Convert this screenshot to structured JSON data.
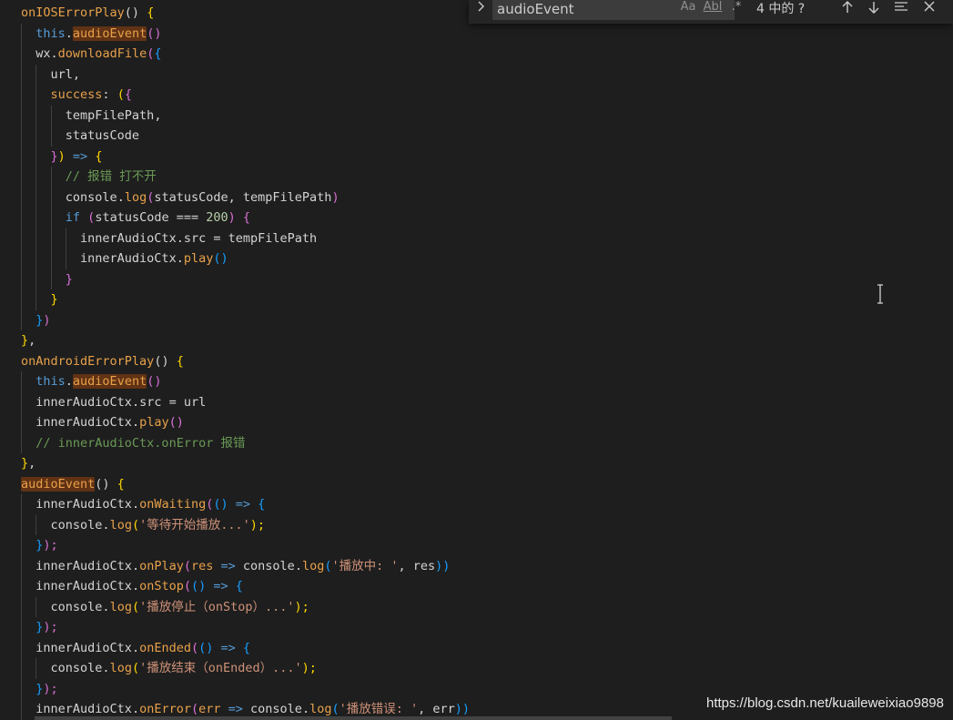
{
  "find": {
    "query": "audioEvent",
    "match_case_label": "Aa",
    "whole_word_label": "Abl",
    "regex_label": ".*",
    "count": "4 中的 ?",
    "toggle_icon": "chevron-right-icon",
    "prev_icon": "arrow-up-icon",
    "next_icon": "arrow-down-icon",
    "selection_icon": "find-in-selection-icon",
    "close_icon": "close-icon"
  },
  "code": {
    "lines": [
      [
        [
          "onIOSErrorPlay",
          "fn"
        ],
        [
          "() ",
          "punc"
        ],
        [
          "{",
          "bracket"
        ]
      ],
      [
        [
          "  "
        ],
        [
          "this",
          "kw"
        ],
        [
          ".",
          "punc"
        ],
        [
          "audioEvent",
          "fn",
          "hl"
        ],
        [
          "()",
          "bracket2"
        ]
      ],
      [
        [
          "  "
        ],
        [
          "wx",
          "var"
        ],
        [
          ".",
          "punc"
        ],
        [
          "downloadFile",
          "fn"
        ],
        [
          "(",
          "bracket2"
        ],
        [
          "{",
          "bracket3"
        ]
      ],
      [
        [
          "    "
        ],
        [
          "url",
          "var"
        ],
        [
          ",",
          "punc"
        ]
      ],
      [
        [
          "    "
        ],
        [
          "success",
          "fn"
        ],
        [
          ": ",
          "punc"
        ],
        [
          "(",
          "bracket"
        ],
        [
          "{",
          "bracket2"
        ]
      ],
      [
        [
          "      "
        ],
        [
          "tempFilePath",
          "var"
        ],
        [
          ",",
          "punc"
        ]
      ],
      [
        [
          "      "
        ],
        [
          "statusCode",
          "var"
        ]
      ],
      [
        [
          "    "
        ],
        [
          "}",
          "bracket2"
        ],
        [
          ")",
          "bracket"
        ],
        [
          " => ",
          "arrow"
        ],
        [
          "{",
          "bracket"
        ]
      ],
      [
        [
          "      "
        ],
        [
          "// 报错 打不开",
          "cmt"
        ]
      ],
      [
        [
          "      "
        ],
        [
          "console",
          "var"
        ],
        [
          ".",
          "punc"
        ],
        [
          "log",
          "fn"
        ],
        [
          "(",
          "bracket2"
        ],
        [
          "statusCode, tempFilePath",
          "var"
        ],
        [
          ")",
          "bracket2"
        ]
      ],
      [
        [
          "      "
        ],
        [
          "if",
          "kw"
        ],
        [
          " (",
          "bracket2"
        ],
        [
          "statusCode === ",
          "var"
        ],
        [
          "200",
          "num"
        ],
        [
          ") ",
          "bracket2"
        ],
        [
          "{",
          "bracket2"
        ]
      ],
      [
        [
          "        "
        ],
        [
          "innerAudioCtx",
          "var"
        ],
        [
          ".src = tempFilePath",
          "var"
        ]
      ],
      [
        [
          "        "
        ],
        [
          "innerAudioCtx",
          "var"
        ],
        [
          ".",
          "punc"
        ],
        [
          "play",
          "fn"
        ],
        [
          "()",
          "bracket3"
        ]
      ],
      [
        [
          "      "
        ],
        [
          "}",
          "bracket2"
        ]
      ],
      [
        [
          "    "
        ],
        [
          "}",
          "bracket"
        ]
      ],
      [
        [
          "  "
        ],
        [
          "}",
          "bracket3"
        ],
        [
          ")",
          "bracket2"
        ]
      ],
      [
        [
          "}",
          "bracket"
        ],
        [
          ",",
          "punc"
        ]
      ],
      [
        [
          "onAndroidErrorPlay",
          "fn"
        ],
        [
          "() ",
          "punc"
        ],
        [
          "{",
          "bracket"
        ]
      ],
      [
        [
          "  "
        ],
        [
          "this",
          "kw"
        ],
        [
          ".",
          "punc"
        ],
        [
          "audioEvent",
          "fn",
          "hl"
        ],
        [
          "()",
          "bracket2"
        ]
      ],
      [
        [
          "  "
        ],
        [
          "innerAudioCtx",
          "var"
        ],
        [
          ".src = url",
          "var"
        ]
      ],
      [
        [
          "  "
        ],
        [
          "innerAudioCtx",
          "var"
        ],
        [
          ".",
          "punc"
        ],
        [
          "play",
          "fn"
        ],
        [
          "()",
          "bracket2"
        ]
      ],
      [
        [
          "  "
        ],
        [
          "// innerAudioCtx.onError 报错",
          "cmt"
        ]
      ],
      [
        [
          "}",
          "bracket"
        ],
        [
          ",",
          "punc"
        ]
      ],
      [
        [
          "audioEvent",
          "fn",
          "hl"
        ],
        [
          "() ",
          "punc"
        ],
        [
          "{",
          "bracket"
        ]
      ],
      [
        [
          "  "
        ],
        [
          "innerAudioCtx",
          "var"
        ],
        [
          ".",
          "punc"
        ],
        [
          "onWaiting",
          "fn"
        ],
        [
          "(",
          "bracket2"
        ],
        [
          "()",
          "bracket3"
        ],
        [
          " => ",
          "arrow"
        ],
        [
          "{",
          "bracket3"
        ]
      ],
      [
        [
          "    "
        ],
        [
          "console",
          "var"
        ],
        [
          ".",
          "punc"
        ],
        [
          "log",
          "fn"
        ],
        [
          "(",
          "bracket"
        ],
        [
          "'等待开始播放...'",
          "str"
        ],
        [
          ");",
          "bracket"
        ]
      ],
      [
        [
          "  "
        ],
        [
          "}",
          "bracket3"
        ],
        [
          ");",
          "bracket2"
        ]
      ],
      [
        [
          "  "
        ],
        [
          "innerAudioCtx",
          "var"
        ],
        [
          ".",
          "punc"
        ],
        [
          "onPlay",
          "fn"
        ],
        [
          "(",
          "bracket2"
        ],
        [
          "res",
          "param"
        ],
        [
          " => ",
          "arrow"
        ],
        [
          "console",
          "var"
        ],
        [
          ".",
          "punc"
        ],
        [
          "log",
          "fn"
        ],
        [
          "(",
          "bracket3"
        ],
        [
          "'播放中: '",
          "str"
        ],
        [
          ", res",
          "var"
        ],
        [
          "))",
          "bracket3"
        ]
      ],
      [
        [
          "  "
        ],
        [
          "innerAudioCtx",
          "var"
        ],
        [
          ".",
          "punc"
        ],
        [
          "onStop",
          "fn"
        ],
        [
          "(",
          "bracket2"
        ],
        [
          "()",
          "bracket3"
        ],
        [
          " => ",
          "arrow"
        ],
        [
          "{",
          "bracket3"
        ]
      ],
      [
        [
          "    "
        ],
        [
          "console",
          "var"
        ],
        [
          ".",
          "punc"
        ],
        [
          "log",
          "fn"
        ],
        [
          "(",
          "bracket"
        ],
        [
          "'播放停止（onStop）...'",
          "str"
        ],
        [
          ");",
          "bracket"
        ]
      ],
      [
        [
          "  "
        ],
        [
          "}",
          "bracket3"
        ],
        [
          ");",
          "bracket2"
        ]
      ],
      [
        [
          "  "
        ],
        [
          "innerAudioCtx",
          "var"
        ],
        [
          ".",
          "punc"
        ],
        [
          "onEnded",
          "fn"
        ],
        [
          "(",
          "bracket2"
        ],
        [
          "()",
          "bracket3"
        ],
        [
          " => ",
          "arrow"
        ],
        [
          "{",
          "bracket3"
        ]
      ],
      [
        [
          "    "
        ],
        [
          "console",
          "var"
        ],
        [
          ".",
          "punc"
        ],
        [
          "log",
          "fn"
        ],
        [
          "(",
          "bracket"
        ],
        [
          "'播放结束（onEnded）...'",
          "str"
        ],
        [
          ");",
          "bracket"
        ]
      ],
      [
        [
          "  "
        ],
        [
          "}",
          "bracket3"
        ],
        [
          ");",
          "bracket2"
        ]
      ],
      [
        [
          "  "
        ],
        [
          "innerAudioCtx",
          "var"
        ],
        [
          ".",
          "punc"
        ],
        [
          "onError",
          "fn"
        ],
        [
          "(",
          "bracket2"
        ],
        [
          "err",
          "param"
        ],
        [
          " => ",
          "arrow"
        ],
        [
          "console",
          "var"
        ],
        [
          ".",
          "punc"
        ],
        [
          "log",
          "fn"
        ],
        [
          "(",
          "bracket3"
        ],
        [
          "'播放错误: '",
          "str"
        ],
        [
          ", err",
          "var"
        ],
        [
          "))",
          "bracket3"
        ]
      ]
    ]
  },
  "watermark": "https://blog.csdn.net/kuaileweixiao9898",
  "cursor_icon": "text-cursor-icon"
}
